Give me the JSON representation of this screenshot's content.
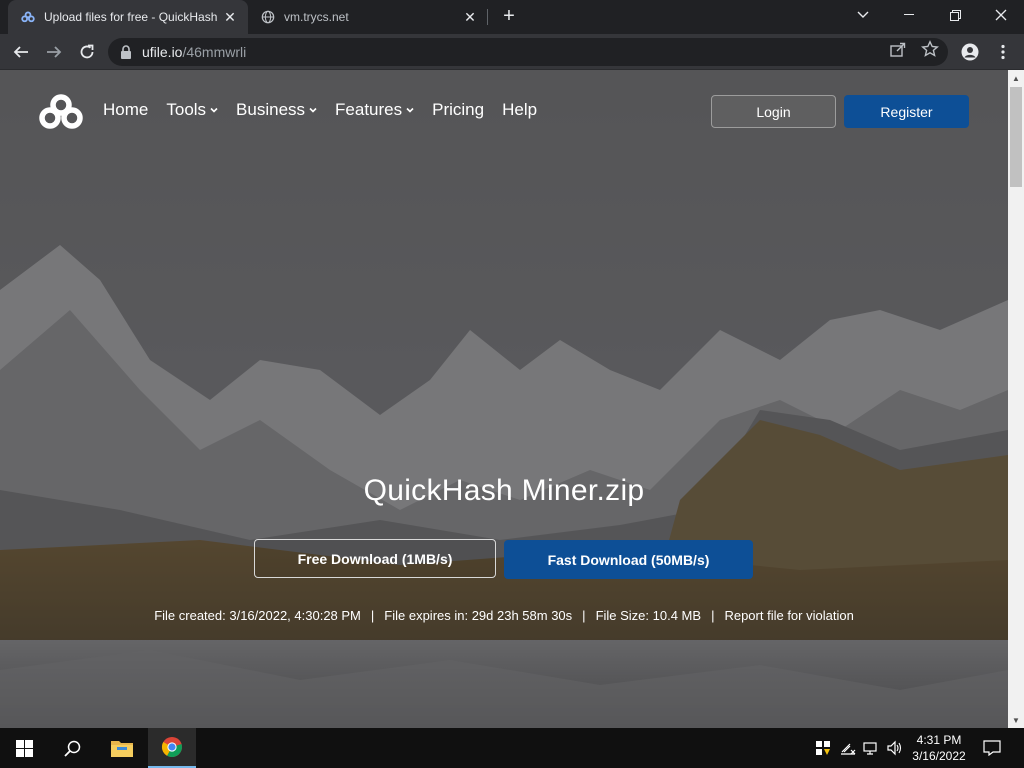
{
  "browser": {
    "tabs": [
      {
        "title": "Upload files for free - QuickHash",
        "active": true
      },
      {
        "title": "vm.trycs.net",
        "active": false
      }
    ],
    "address": {
      "domain": "ufile.io",
      "path": "/46mmwrli"
    }
  },
  "site": {
    "nav": {
      "items": [
        {
          "label": "Home",
          "has_caret": false
        },
        {
          "label": "Tools",
          "has_caret": true
        },
        {
          "label": "Business",
          "has_caret": true
        },
        {
          "label": "Features",
          "has_caret": true
        },
        {
          "label": "Pricing",
          "has_caret": false
        },
        {
          "label": "Help",
          "has_caret": false
        }
      ],
      "login_label": "Login",
      "register_label": "Register"
    },
    "file": {
      "name": "QuickHash Miner.zip",
      "free_download_label": "Free Download (1MB/s)",
      "fast_download_label": "Fast Download (50MB/s)",
      "created": "File created: 3/16/2022, 4:30:28 PM",
      "expires": "File expires in: 29d 23h 58m 30s",
      "size": "File Size: 10.4 MB",
      "report": "Report file for violation",
      "separator": "|"
    },
    "colors": {
      "accent": "#0d4f96"
    }
  },
  "taskbar": {
    "time": "4:31 PM",
    "date": "3/16/2022"
  }
}
